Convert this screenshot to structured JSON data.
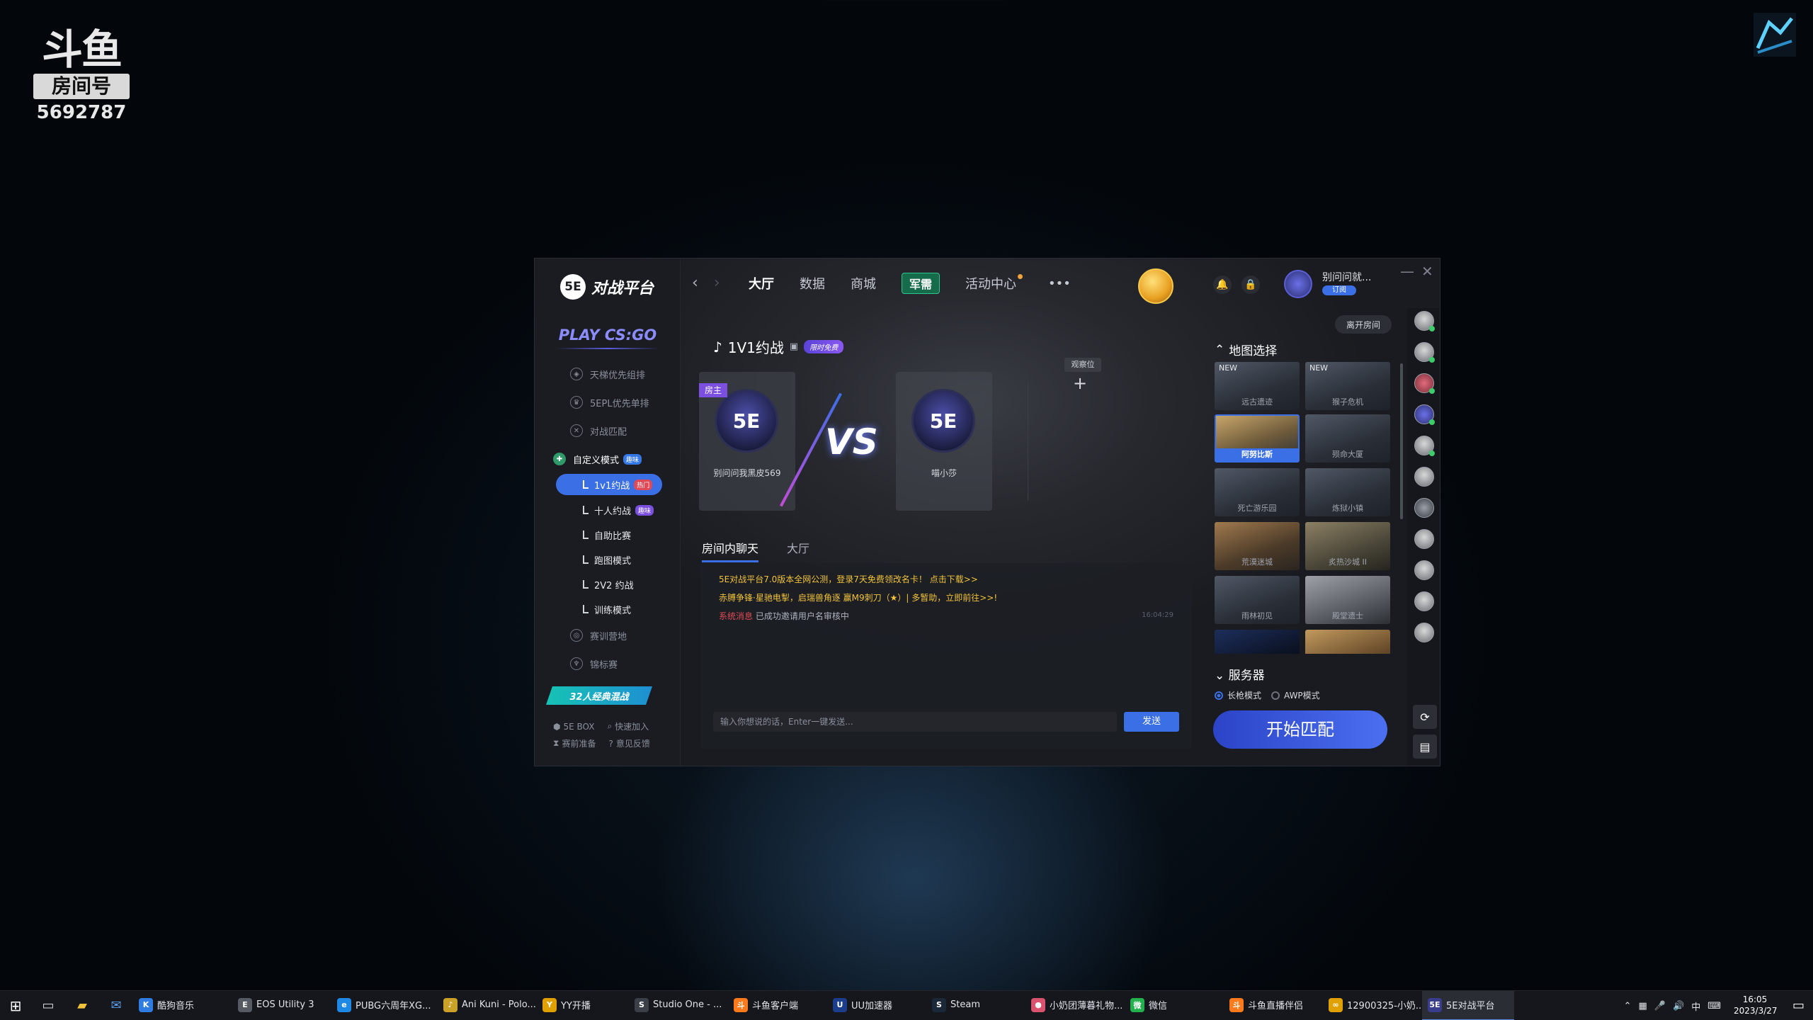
{
  "watermark": {
    "logo": "斗鱼",
    "room_label": "房间号",
    "room_id": "5692787"
  },
  "app": {
    "brand": "对战平台",
    "brand_badge": "5E",
    "play_title": "PLAY CS:GO",
    "nav": {
      "tabs": [
        "大厅",
        "数据",
        "商城",
        "军需",
        "活动中心"
      ],
      "more": "•••"
    },
    "user": {
      "name": "别问问就...",
      "badge": "订阅"
    },
    "window_controls": {
      "minimize": "—",
      "close": "✕"
    }
  },
  "sidebar": {
    "items": [
      {
        "label": "天梯优先组排",
        "icon": "shield-icon"
      },
      {
        "label": "5EPL优先单排",
        "icon": "trophy-icon"
      },
      {
        "label": "对战匹配",
        "icon": "swords-icon"
      }
    ],
    "custom_mode": {
      "label": "自定义模式",
      "tag": "趣味"
    },
    "sub_items": [
      {
        "label": "1v1约战",
        "tag": "热门"
      },
      {
        "label": "十人约战",
        "tag": "趣味"
      },
      {
        "label": "自助比赛",
        "tag": ""
      },
      {
        "label": "跑图模式",
        "tag": ""
      },
      {
        "label": "2V2 约战",
        "tag": ""
      },
      {
        "label": "训练模式",
        "tag": ""
      }
    ],
    "bottom_items": [
      {
        "label": "赛训营地",
        "icon": "target-icon"
      },
      {
        "label": "锦标赛",
        "icon": "cup-icon"
      }
    ],
    "promo": "32人经典混战",
    "footer": [
      {
        "label": "5E BOX",
        "icon": "box-icon"
      },
      {
        "label": "快速加入",
        "icon": "search-icon"
      },
      {
        "label": "赛前准备",
        "icon": "hourglass-icon"
      },
      {
        "label": "意见反馈",
        "icon": "help-icon"
      }
    ]
  },
  "room": {
    "leave_label": "离开房间",
    "title": "1V1约战",
    "title_tag": "限时免费",
    "host_label": "房主",
    "player1": "别问问我黑皮569",
    "player2": "喵小莎",
    "vs": "VS",
    "observer_label": "观察位",
    "observer_add": "+"
  },
  "chat": {
    "tabs": [
      "房间内聊天",
      "大厅"
    ],
    "messages": [
      {
        "text": "5E对战平台7.0版本全网公测，登录7天免费领改名卡！ 点击下载>>"
      },
      {
        "text": "赤膊争锋·星驰电掣，启瑞兽角逐 赢M9刺刀（★）| 多暂助，立即前往>>!"
      }
    ],
    "system_prefix": "系统消息",
    "system_text": "已成功邀请用户名审核中",
    "system_time": "16:04:29",
    "input_placeholder": "输入你想说的话，Enter一键发送...",
    "send_label": "发送"
  },
  "maps": {
    "heading": "地图选择",
    "items": [
      {
        "name": "远古遗迹",
        "new": "NEW",
        "selected": false
      },
      {
        "name": "猴子危机",
        "new": "NEW",
        "selected": false
      },
      {
        "name": "阿努比斯",
        "new": "",
        "selected": true
      },
      {
        "name": "殒命大厦",
        "new": "",
        "selected": false
      },
      {
        "name": "死亡游乐园",
        "new": "",
        "selected": false
      },
      {
        "name": "炼狱小镇",
        "new": "",
        "selected": false
      },
      {
        "name": "荒漠迷城",
        "new": "",
        "selected": false
      },
      {
        "name": "炙热沙城 II",
        "new": "",
        "selected": false
      },
      {
        "name": "雨林初见",
        "new": "",
        "selected": false
      },
      {
        "name": "殿堂遗士",
        "new": "",
        "selected": false
      },
      {
        "name": "",
        "new": "",
        "selected": false
      },
      {
        "name": "",
        "new": "",
        "selected": false
      }
    ]
  },
  "server": {
    "heading": "服务器",
    "options": [
      {
        "label": "长枪模式",
        "selected": true
      },
      {
        "label": "AWP模式",
        "selected": false
      }
    ],
    "start_label": "开始匹配"
  },
  "taskbar": {
    "apps": [
      {
        "label": "酷狗音乐",
        "icon": "K",
        "color": "#2f7de1"
      },
      {
        "label": "EOS Utility 3",
        "icon": "E",
        "color": "#555a63"
      },
      {
        "label": "PUBG六周年XG...",
        "icon": "e",
        "color": "#1e88e5"
      },
      {
        "label": "Ani Kuni - Polo...",
        "icon": "♪",
        "color": "#c9a227"
      },
      {
        "label": "YY开播",
        "icon": "Y",
        "color": "#e0a100"
      },
      {
        "label": "Studio One - ...",
        "icon": "S",
        "color": "#3b4048"
      },
      {
        "label": "斗鱼客户端",
        "icon": "斗",
        "color": "#ff7a1a"
      },
      {
        "label": "UU加速器",
        "icon": "U",
        "color": "#1c3d8c"
      },
      {
        "label": "Steam",
        "icon": "S",
        "color": "#1b2838"
      },
      {
        "label": "小奶团薄暮礼物...",
        "icon": "●",
        "color": "#d9536f"
      },
      {
        "label": "微信",
        "icon": "微",
        "color": "#22b14c"
      },
      {
        "label": "斗鱼直播伴侣",
        "icon": "斗",
        "color": "#ff7a1a"
      },
      {
        "label": "12900325-小奶...",
        "icon": "∞",
        "color": "#e0a100"
      },
      {
        "label": "5E对战平台",
        "icon": "5E",
        "color": "#3a3d8c"
      }
    ],
    "tray_lang": "中",
    "time": "16:05",
    "date": "2023/3/27"
  },
  "colors": {
    "accent": "#3a6fe6",
    "start_button": "#2c44c7",
    "host_tag": "#7b4fe0",
    "chat_yellow": "#f2c33a",
    "system_red": "#e04a57"
  }
}
